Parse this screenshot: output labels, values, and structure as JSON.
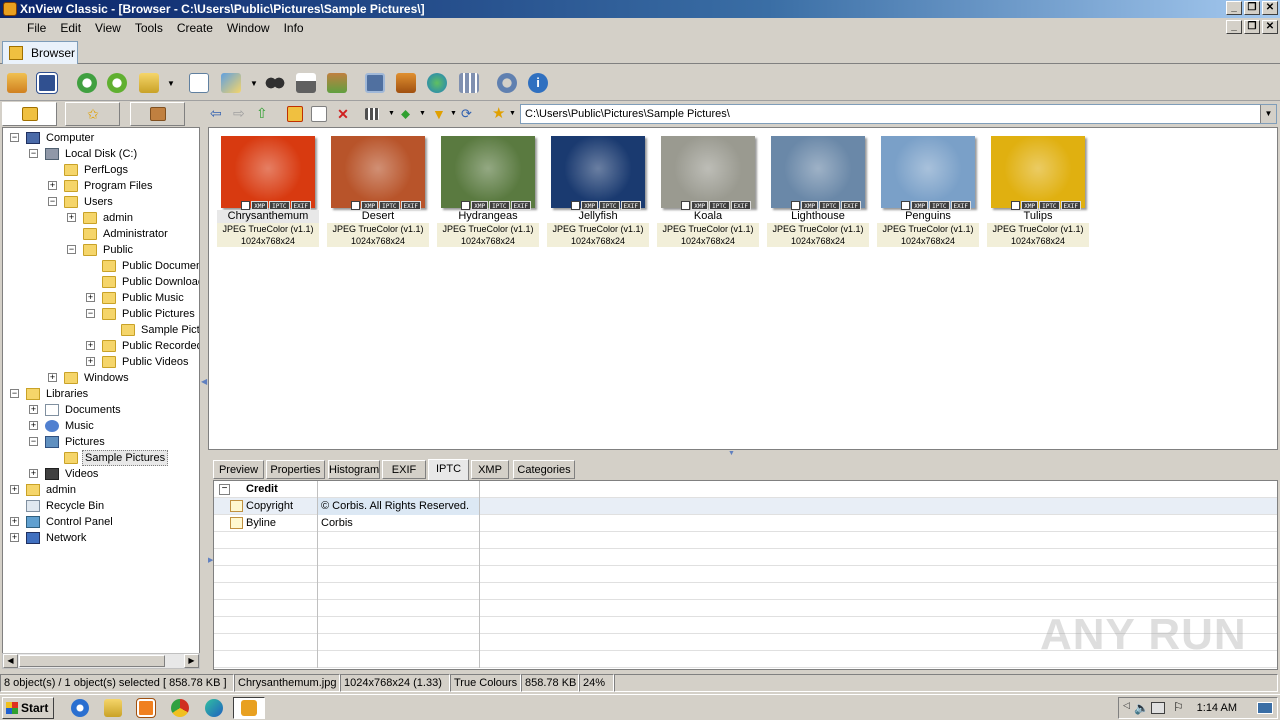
{
  "window": {
    "title": "XnView Classic - [Browser - C:\\Users\\Public\\Pictures\\Sample Pictures\\]"
  },
  "menu": [
    "File",
    "Edit",
    "View",
    "Tools",
    "Create",
    "Window",
    "Info"
  ],
  "doc_tab": "Browser",
  "path": "C:\\Users\\Public\\Pictures\\Sample Pictures\\",
  "tree": [
    {
      "label": "Computer",
      "icon": "computer-icon",
      "level": 0,
      "exp": "-",
      "open": true
    },
    {
      "label": "Local Disk (C:)",
      "icon": "disk-icon",
      "level": 1,
      "exp": "-"
    },
    {
      "label": "PerfLogs",
      "icon": "folder-icon",
      "level": 2,
      "exp": ""
    },
    {
      "label": "Program Files",
      "icon": "folder-icon",
      "level": 2,
      "exp": "+"
    },
    {
      "label": "Users",
      "icon": "folder-icon",
      "level": 2,
      "exp": "-"
    },
    {
      "label": "admin",
      "icon": "folder-icon",
      "level": 3,
      "exp": "+"
    },
    {
      "label": "Administrator",
      "icon": "folder-icon",
      "level": 3,
      "exp": ""
    },
    {
      "label": "Public",
      "icon": "folder-icon",
      "level": 3,
      "exp": "-"
    },
    {
      "label": "Public Documen",
      "icon": "folder-icon",
      "level": 4,
      "exp": ""
    },
    {
      "label": "Public Downloac",
      "icon": "folder-icon",
      "level": 4,
      "exp": ""
    },
    {
      "label": "Public Music",
      "icon": "folder-icon",
      "level": 4,
      "exp": "+"
    },
    {
      "label": "Public Pictures",
      "icon": "folder-icon",
      "level": 4,
      "exp": "-"
    },
    {
      "label": "Sample Pictu",
      "icon": "folder-icon",
      "level": 5,
      "exp": ""
    },
    {
      "label": "Public Recorded",
      "icon": "folder-icon",
      "level": 4,
      "exp": "+"
    },
    {
      "label": "Public Videos",
      "icon": "folder-icon",
      "level": 4,
      "exp": "+"
    },
    {
      "label": "Windows",
      "icon": "folder-icon",
      "level": 2,
      "exp": "+"
    },
    {
      "label": "Libraries",
      "icon": "libraries-icon",
      "level": 0,
      "exp": "-"
    },
    {
      "label": "Documents",
      "icon": "documents-icon",
      "level": 1,
      "exp": "+"
    },
    {
      "label": "Music",
      "icon": "music-icon",
      "level": 1,
      "exp": "+"
    },
    {
      "label": "Pictures",
      "icon": "pictures-icon",
      "level": 1,
      "exp": "-"
    },
    {
      "label": "Sample Pictures",
      "icon": "folder-icon",
      "level": 2,
      "exp": "",
      "selected": true
    },
    {
      "label": "Videos",
      "icon": "videos-icon",
      "level": 1,
      "exp": "+"
    },
    {
      "label": "admin",
      "icon": "user-folder-icon",
      "level": 0,
      "exp": "+"
    },
    {
      "label": "Recycle Bin",
      "icon": "recycle-bin-icon",
      "level": 0,
      "exp": ""
    },
    {
      "label": "Control Panel",
      "icon": "control-panel-icon",
      "level": 0,
      "exp": "+"
    },
    {
      "label": "Network",
      "icon": "network-icon",
      "level": 0,
      "exp": "+"
    }
  ],
  "thumbs": [
    {
      "name": "Chrysanthemum",
      "meta1": "JPEG TrueColor (v1.1)",
      "meta2": "1024x768x24",
      "color": "#d83a10",
      "selected": true
    },
    {
      "name": "Desert",
      "meta1": "JPEG TrueColor (v1.1)",
      "meta2": "1024x768x24",
      "color": "#b8542a"
    },
    {
      "name": "Hydrangeas",
      "meta1": "JPEG TrueColor (v1.1)",
      "meta2": "1024x768x24",
      "color": "#5a7a40"
    },
    {
      "name": "Jellyfish",
      "meta1": "JPEG TrueColor (v1.1)",
      "meta2": "1024x768x24",
      "color": "#1a3a70"
    },
    {
      "name": "Koala",
      "meta1": "JPEG TrueColor (v1.1)",
      "meta2": "1024x768x24",
      "color": "#9a9a90"
    },
    {
      "name": "Lighthouse",
      "meta1": "JPEG TrueColor (v1.1)",
      "meta2": "1024x768x24",
      "color": "#6a88a8"
    },
    {
      "name": "Penguins",
      "meta1": "JPEG TrueColor (v1.1)",
      "meta2": "1024x768x24",
      "color": "#7aa0c8"
    },
    {
      "name": "Tulips",
      "meta1": "JPEG TrueColor (v1.1)",
      "meta2": "1024x768x24",
      "color": "#e0b010"
    }
  ],
  "badges": [
    "XMP",
    "IPTC",
    "EXIF"
  ],
  "info_tabs": [
    "Preview",
    "Properties",
    "Histogram",
    "EXIF",
    "IPTC",
    "XMP",
    "Categories"
  ],
  "info_active": "IPTC",
  "iptc": {
    "group": "Credit",
    "rows": [
      {
        "key": "Copyright",
        "value": "© Corbis.  All Rights Reserved."
      },
      {
        "key": "Byline",
        "value": "Corbis"
      }
    ]
  },
  "status": [
    "8 object(s) / 1 object(s) selected  [ 858.78 KB ]",
    "Chrysanthemum.jpg",
    "1024x768x24 (1.33)",
    "True Colours",
    "858.78 KB",
    "24%"
  ],
  "taskbar": {
    "start": "Start",
    "clock": "1:14 AM"
  },
  "watermark": "ANY RUN"
}
